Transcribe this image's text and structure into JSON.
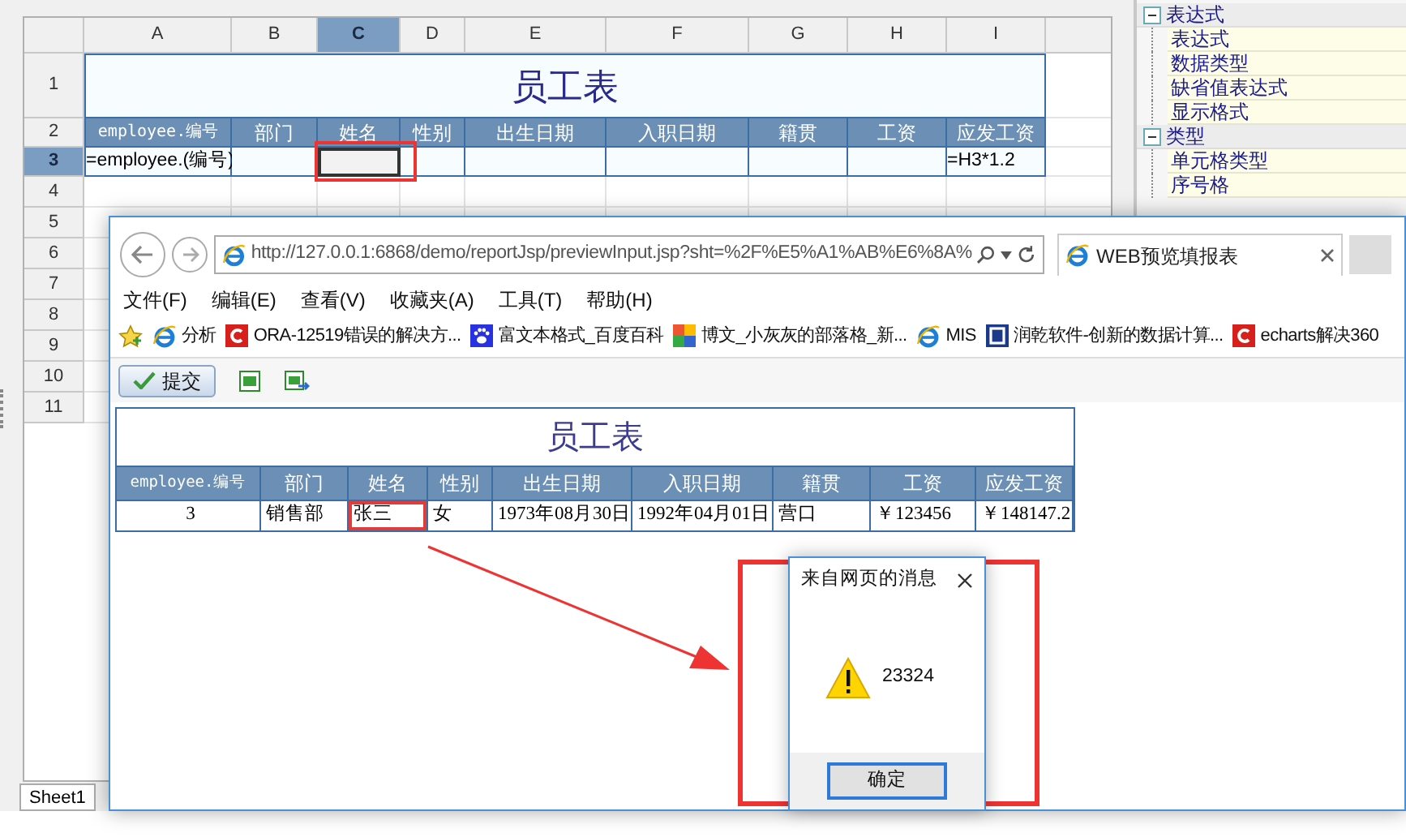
{
  "spreadsheet": {
    "columns": [
      {
        "label": "A",
        "selected": false
      },
      {
        "label": "B",
        "selected": false
      },
      {
        "label": "C",
        "selected": true
      },
      {
        "label": "D",
        "selected": false
      },
      {
        "label": "E",
        "selected": false
      },
      {
        "label": "F",
        "selected": false
      },
      {
        "label": "G",
        "selected": false
      },
      {
        "label": "H",
        "selected": false
      },
      {
        "label": "I",
        "selected": false
      }
    ],
    "rows": [
      {
        "label": "1",
        "selected": false
      },
      {
        "label": "2",
        "selected": false
      },
      {
        "label": "3",
        "selected": true
      },
      {
        "label": "4",
        "selected": false
      },
      {
        "label": "5",
        "selected": false
      },
      {
        "label": "6",
        "selected": false
      },
      {
        "label": "7",
        "selected": false
      },
      {
        "label": "8",
        "selected": false
      },
      {
        "label": "9",
        "selected": false
      },
      {
        "label": "10",
        "selected": false
      },
      {
        "label": "11",
        "selected": false
      }
    ],
    "title": "员工表",
    "headers": [
      "employee.编号",
      "部门",
      "姓名",
      "性别",
      "出生日期",
      "入职日期",
      "籍贯",
      "工资",
      "应发工资"
    ],
    "row3": [
      {
        "text": "=employee.(编号)",
        "selected": false
      },
      {
        "selected": false
      },
      {
        "selected": true
      },
      {
        "selected": false
      },
      {
        "selected": false
      },
      {
        "selected": false
      },
      {
        "selected": false
      },
      {
        "selected": false
      },
      {
        "text": "=H3*1.2",
        "selected": false
      }
    ],
    "sheet_tabs": [
      {
        "label": "Sheet1",
        "selected": true
      }
    ]
  },
  "property_tree": [
    {
      "label": "表达式",
      "expanded": true,
      "children": [
        {
          "label": "表达式"
        },
        {
          "label": "数据类型"
        },
        {
          "label": "缺省值表达式"
        },
        {
          "label": "显示格式"
        }
      ]
    },
    {
      "label": "类型",
      "expanded": true,
      "children": [
        {
          "label": "单元格类型"
        },
        {
          "label": "序号格"
        }
      ]
    }
  ],
  "browser": {
    "address": "http://127.0.0.1:6868/demo/reportJsp/previewInput.jsp?sht=%2F%E5%A1%AB%E6%8A%",
    "tab_title": "WEB预览填报表",
    "menu": [
      "文件(F)",
      "编辑(E)",
      "查看(V)",
      "收藏夹(A)",
      "工具(T)",
      "帮助(H)"
    ],
    "bookmarks": [
      {
        "label": "分析",
        "kind": "ie"
      },
      {
        "label": "ORA-12519错误的解决方...",
        "kind": "red"
      },
      {
        "label": "富文本格式_百度百科",
        "kind": "paw"
      },
      {
        "label": "博文_小灰灰的部落格_新...",
        "kind": "mosaic"
      },
      {
        "label": "MIS",
        "kind": "ie"
      },
      {
        "label": "润乾软件-创新的数据计算...",
        "kind": "blue"
      },
      {
        "label": "echarts解决360",
        "kind": "red"
      }
    ],
    "submit_button": "提交",
    "report": {
      "title": "员工表",
      "columns": [
        "employee.编号",
        "部门",
        "姓名",
        "性别",
        "出生日期",
        "入职日期",
        "籍贯",
        "工资",
        "应发工资"
      ],
      "rows": [
        [
          {
            "text": "3",
            "selected": false
          },
          {
            "text": "销售部",
            "selected": false
          },
          {
            "text": "张三",
            "selected": true
          },
          {
            "text": "女",
            "selected": false
          },
          {
            "text": "1973年08月30日",
            "selected": false
          },
          {
            "text": "1992年04月01日",
            "selected": false
          },
          {
            "text": "营口",
            "selected": false
          },
          {
            "text": "￥123456",
            "selected": false
          },
          {
            "text": "￥148147.2",
            "selected": false
          }
        ]
      ]
    }
  },
  "dialog": {
    "title": "来自网页的消息",
    "message": "23324",
    "ok_button": "确定"
  }
}
